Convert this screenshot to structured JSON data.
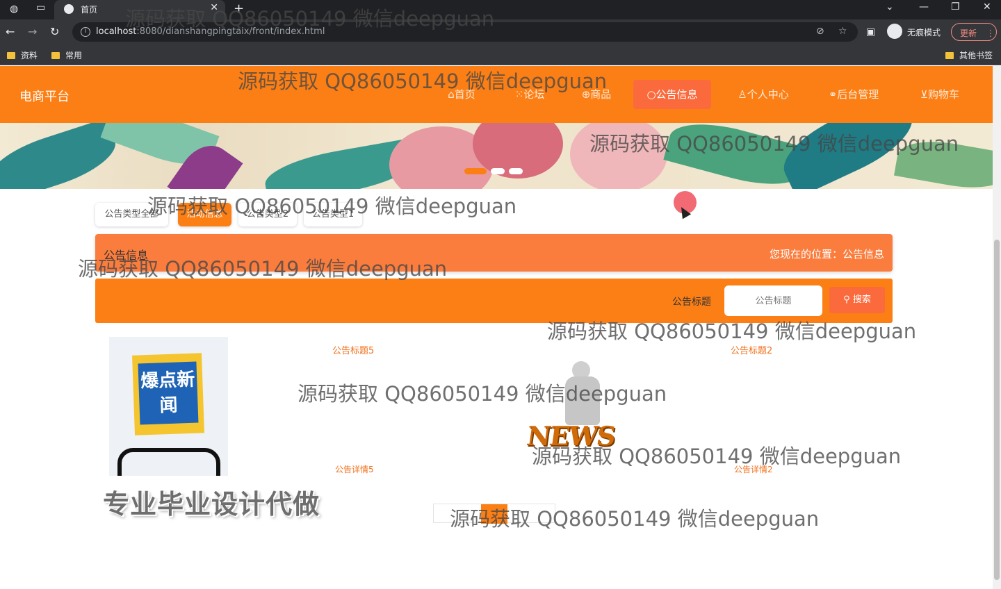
{
  "browser": {
    "tab_title": "首页",
    "url_host": "localhost",
    "url_rest": ":8080/dianshangpingtaix/front/index.html",
    "incognito_label": "无痕模式",
    "update_label": "更新",
    "bookmarks": [
      "资料",
      "常用"
    ],
    "other_bookmarks": "其他书签"
  },
  "site": {
    "logo": "电商平台",
    "nav": [
      "首页",
      "论坛",
      "商品",
      "公告信息",
      "个人中心",
      "后台管理",
      "购物车"
    ],
    "nav_icons": [
      "home-icon",
      "forum-icon",
      "goods-icon",
      "notice-icon",
      "user-icon",
      "link-icon",
      "cart-icon"
    ],
    "active_nav": "公告信息",
    "categories": [
      "公告类型全部",
      "活动信息",
      "公告类型2",
      "公告类型1"
    ],
    "active_category": "活动信息",
    "page_title": "公告信息",
    "breadcrumb": "您现在的位置：公告信息",
    "search": {
      "label": "公告标题",
      "placeholder": "公告标题",
      "button": "搜索"
    },
    "cards": [
      {
        "title": "公告标题5",
        "desc": "公告详情5",
        "image_text": "爆点新闻"
      },
      {
        "title": "公告标题2",
        "desc": "公告详情2",
        "image_text": "NEWS"
      }
    ],
    "promo": "专业毕业设计代做"
  },
  "watermark": "源码获取 QQ86050149 微信deepguan",
  "colors": {
    "primary": "#fc7f15",
    "accent": "#fb6a3c"
  }
}
